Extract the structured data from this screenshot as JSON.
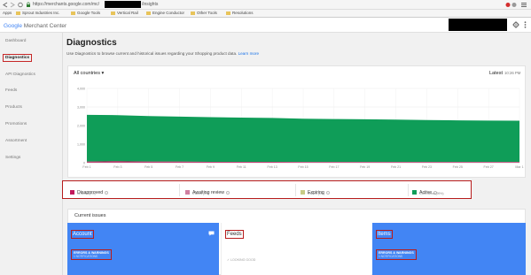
{
  "browser": {
    "url_prefix": "https://merchants.google.com/mc/",
    "url_suffix": "/insights",
    "bookmarks": [
      "Apps",
      "Sprout Industries Inc.",
      "Google Tools",
      "Vertical Rail",
      "Engine Conductor",
      "Other Tools",
      "Resolutions"
    ]
  },
  "app": {
    "logo_google": "Google",
    "logo_rest": " Merchant Center"
  },
  "sidebar": {
    "items": [
      {
        "label": "Dashboard"
      },
      {
        "label": "Diagnostics"
      },
      {
        "label": "API Diagnostics"
      },
      {
        "label": "Feeds"
      },
      {
        "label": "Products"
      },
      {
        "label": "Promotions"
      },
      {
        "label": "Assortment"
      },
      {
        "label": "Settings"
      }
    ]
  },
  "page": {
    "title": "Diagnostics",
    "subtitle": "Use Diagnostics to browse current and historical issues regarding your Shopping product data.",
    "learn_more": "Learn more",
    "country_selector": "All countries",
    "latest_label": "Latest",
    "latest_time": "10:26 PM"
  },
  "chart_data": {
    "type": "area",
    "x": [
      "Feb 1",
      "Feb 3",
      "Feb 5",
      "Feb 7",
      "Feb 9",
      "Feb 11",
      "Feb 13",
      "Feb 15",
      "Feb 17",
      "Feb 19",
      "Feb 21",
      "Feb 23",
      "Feb 25",
      "Feb 27",
      "Mar 1"
    ],
    "yticks": [
      "0",
      "1,000",
      "2,000",
      "3,000",
      "4,000"
    ],
    "ylim": [
      0,
      4000
    ],
    "series": [
      {
        "name": "Disapproved",
        "color": "#c2185b",
        "values": [
          60,
          80,
          60,
          60,
          50,
          50,
          50,
          40,
          40,
          40,
          40,
          40,
          40,
          40,
          40
        ]
      },
      {
        "name": "Active",
        "color": "#0f9d58",
        "values": [
          2520,
          2480,
          2450,
          2420,
          2400,
          2380,
          2360,
          2330,
          2310,
          2300,
          2280,
          2260,
          2240,
          2230,
          2220
        ]
      }
    ],
    "grid": true
  },
  "legend": [
    {
      "label": "Disapproved",
      "sub": "11 items (1%)",
      "color": "#c2185b"
    },
    {
      "label": "Awaiting review",
      "sub": "0 items (0%)",
      "color": "#d07fa0"
    },
    {
      "label": "Expiring",
      "sub": "0 items (0%)",
      "color": "#c7cb86"
    },
    {
      "label": "Active",
      "sub": "1,509 items (99%)",
      "color": "#0f9d58"
    }
  ],
  "issues": {
    "title": "Current issues",
    "account": {
      "title": "Account",
      "errors": "ERRORS & WARNINGS",
      "sub": "1 NOTIFICATIONS"
    },
    "feeds": {
      "title": "Feeds",
      "status": "LOOKING GOOD"
    },
    "items": {
      "title": "Items",
      "errors": "ERRORS & WARNINGS",
      "sub": "1 NOTIFICATIONS"
    }
  }
}
